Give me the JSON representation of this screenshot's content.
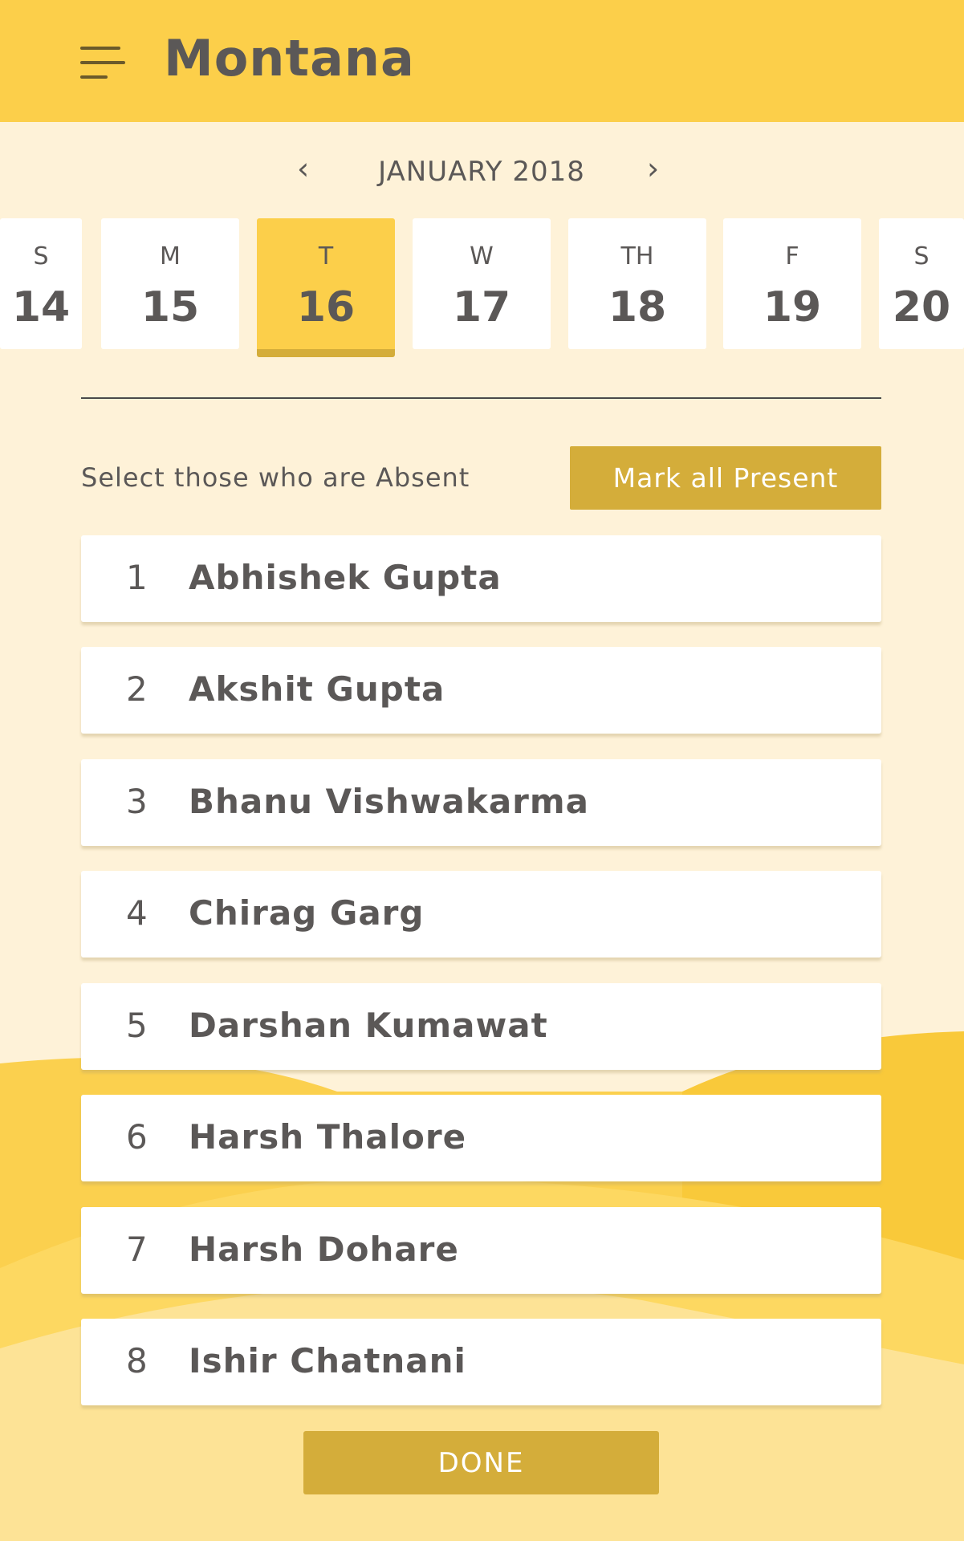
{
  "header": {
    "title": "Montana",
    "menu_icon": "hamburger-menu-icon"
  },
  "calendar": {
    "month_label": "JANUARY 2018",
    "prev_icon": "chevron-left-icon",
    "next_icon": "chevron-right-icon",
    "days": [
      {
        "weekday": "S",
        "date": "14"
      },
      {
        "weekday": "M",
        "date": "15"
      },
      {
        "weekday": "T",
        "date": "16",
        "selected": true
      },
      {
        "weekday": "W",
        "date": "17"
      },
      {
        "weekday": "TH",
        "date": "18"
      },
      {
        "weekday": "F",
        "date": "19"
      },
      {
        "weekday": "S",
        "date": "20"
      }
    ]
  },
  "attendance": {
    "instruction": "Select those who are Absent",
    "mark_all_label": "Mark all Present",
    "students": [
      {
        "num": "1",
        "name": "Abhishek Gupta"
      },
      {
        "num": "2",
        "name": "Akshit Gupta"
      },
      {
        "num": "3",
        "name": "Bhanu Vishwakarma"
      },
      {
        "num": "4",
        "name": "Chirag Garg"
      },
      {
        "num": "5",
        "name": "Darshan Kumawat"
      },
      {
        "num": "6",
        "name": "Harsh Thalore"
      },
      {
        "num": "7",
        "name": "Harsh Dohare"
      },
      {
        "num": "8",
        "name": "Ishir Chatnani"
      }
    ],
    "done_label": "DONE"
  },
  "colors": {
    "header": "#fccf4a",
    "accent": "#d4ad3a",
    "background": "#fef2d8",
    "text": "#5b5857"
  }
}
